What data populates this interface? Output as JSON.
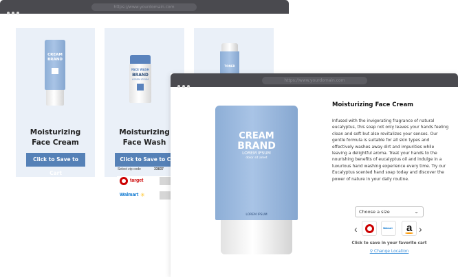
{
  "back_window": {
    "url": "https://www.yourdomain.com",
    "cards": [
      {
        "brand_top": "CREAM",
        "brand_main": "BRAND",
        "name_line1": "Moisturizing",
        "name_line2": "Face Cream",
        "button": "Click to Save to Cart"
      },
      {
        "brand_top": "FACE WASH",
        "brand_main": "BRAND",
        "sub": "LOREM IPSUM",
        "name_line1": "Moisturizing",
        "name_line2": "Face Wash",
        "button": "Click to Save to Cart",
        "zip_label": "Select zip code",
        "zip_value": "33837",
        "retailers": [
          "target",
          "Walmart"
        ]
      },
      {
        "brand_top": "TONER"
      }
    ]
  },
  "front_window": {
    "url": "https://www.yourdomain.com",
    "product_image": {
      "brand_top": "CREAM",
      "brand_main": "BRAND",
      "sub": "LOREM IPSUM",
      "sub2": "dolor sit amet",
      "bottom": "LOREM IPSUM"
    },
    "title": "Moisturizing Face Cream",
    "description": "Infused with the invigorating fragrance of natural eucalyptus, this soap not only leaves your hands feeling clean and soft but also revitalizes your senses. Our gentle formula is suitable for all skin types and effectively washes away dirt and impurities while leaving a delightful aroma. Treat your hands to the nourishing benefits of eucalyptus oil and indulge in a luxurious hand washing experience every time. Try our Eucalyptus scented hand soap today and discover the power of nature in your daily routine.",
    "size_select": "Choose a size",
    "retailers": [
      "target",
      "Walmart",
      "amazon"
    ],
    "favorite_cart_text": "Click to save in your favorite cart",
    "change_location": "Change Location",
    "colors": {
      "accent": "#5581b7",
      "link": "#3a8fd9",
      "titlebar": "#4a4a4f"
    }
  }
}
